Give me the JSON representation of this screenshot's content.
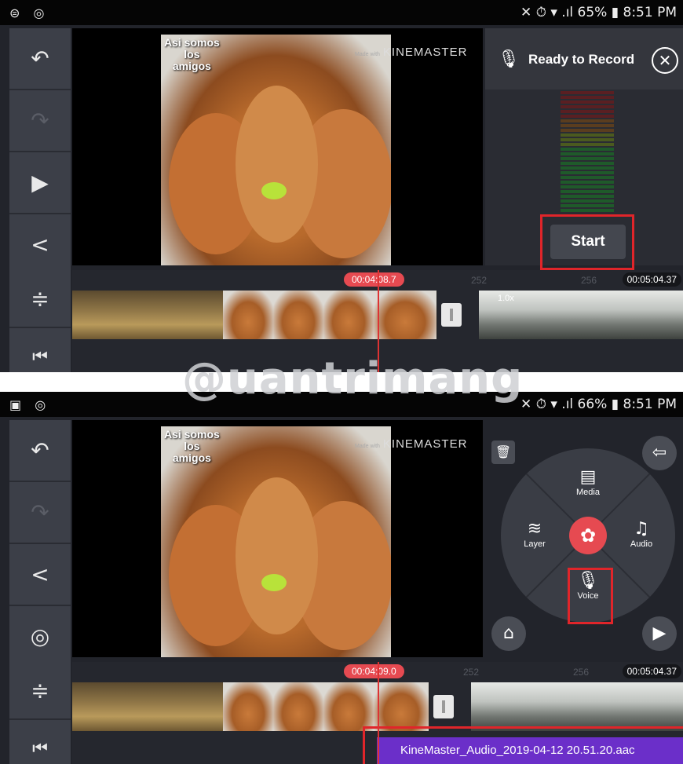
{
  "panel_top": {
    "status": {
      "left_icons": "⊜ ◎",
      "right_text": "✕ ⏱ ▾ .ıl 65% ▮ 8:51 PM"
    },
    "tools": [
      {
        "name": "undo",
        "glyph": "↶"
      },
      {
        "name": "redo",
        "glyph": "↷"
      },
      {
        "name": "play",
        "glyph": "▶"
      },
      {
        "name": "share",
        "glyph": "<"
      }
    ],
    "preview": {
      "overlay_text": "Asi somos\nlos\namigos",
      "watermark_small": "Made with",
      "watermark": "KINEMASTER"
    },
    "recorder": {
      "title": "Ready to Record",
      "start_label": "Start",
      "close_glyph": "✕",
      "mic_glyph": "🎙"
    },
    "timeline": {
      "playhead_time": "00:04:08.7",
      "end_time": "00:05:04.37",
      "ticks": [
        "252",
        "256"
      ],
      "clip_label": "1.0x"
    },
    "timeline_tools": [
      {
        "glyph": "≑"
      },
      {
        "glyph": "⏮"
      }
    ]
  },
  "panel_bottom": {
    "status": {
      "left_icons": "▣ ◎",
      "right_text": "✕ ⏱ ▾ .ıl 66% ▮ 8:51 PM"
    },
    "tools": [
      {
        "name": "undo",
        "glyph": "↶"
      },
      {
        "name": "redo",
        "glyph": "↷"
      },
      {
        "name": "share",
        "glyph": "<"
      },
      {
        "name": "settings",
        "glyph": "◎"
      }
    ],
    "preview": {
      "overlay_text": "Asi somos\nlos\namigos",
      "watermark_small": "Made with",
      "watermark": "KINEMASTER"
    },
    "wheel": {
      "media": "Media",
      "layer": "Layer",
      "audio": "Audio",
      "voice": "Voice",
      "media_glyph": "▤",
      "layer_glyph": "≋",
      "audio_glyph": "♫",
      "voice_glyph": "🎙",
      "record_glyph": "✿",
      "exit_glyph": "⇦",
      "play_glyph": "▶",
      "store_glyph": "⌂",
      "trash_glyph": "🗑"
    },
    "timeline": {
      "playhead_time": "00:04:09.0",
      "end_time": "00:05:04.37",
      "ticks": [
        "252",
        "256"
      ]
    },
    "audio_track": "KineMaster_Audio_2019-04-12 20.51.20.aac",
    "timeline_tools": [
      {
        "glyph": "≑"
      },
      {
        "glyph": "⏮"
      }
    ]
  },
  "site_watermark": "@uantrimang",
  "colors": {
    "accent_red": "#e64a51",
    "highlight": "#e0252a",
    "audio_track": "#6b2fc9"
  }
}
